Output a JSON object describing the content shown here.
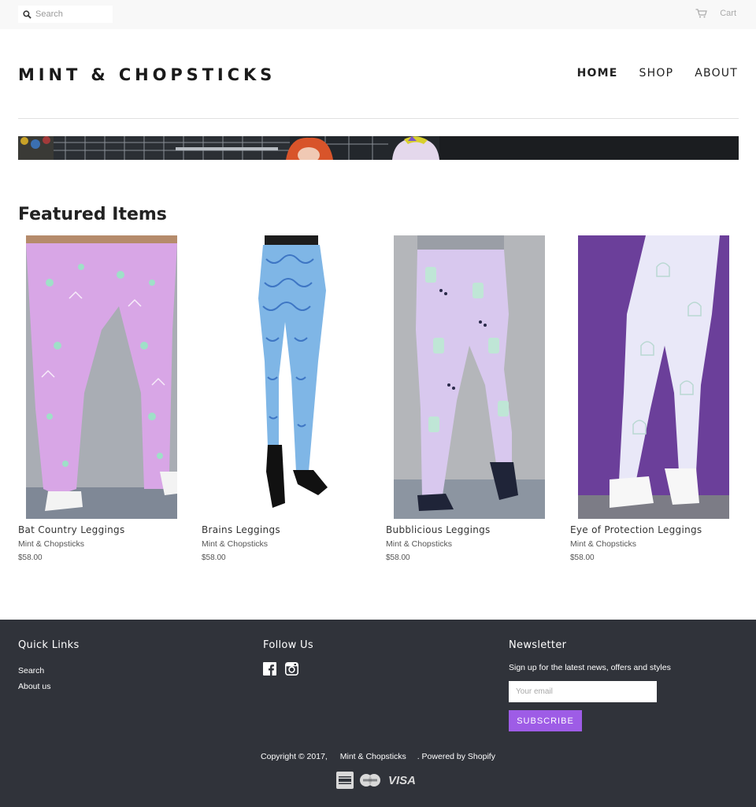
{
  "topbar": {
    "search_placeholder": "Search",
    "cart_label": "Cart"
  },
  "header": {
    "logo": "MINT & CHOPSTICKS",
    "nav": [
      "HOME",
      "SHOP",
      "ABOUT"
    ]
  },
  "featured": {
    "title": "Featured Items",
    "products": [
      {
        "name": "Bat Country Leggings",
        "vendor": "Mint & Chopsticks",
        "price": "$58.00"
      },
      {
        "name": "Brains Leggings",
        "vendor": "Mint & Chopsticks",
        "price": "$58.00"
      },
      {
        "name": "Bubblicious Leggings",
        "vendor": "Mint & Chopsticks",
        "price": "$58.00"
      },
      {
        "name": "Eye of Protection Leggings",
        "vendor": "Mint & Chopsticks",
        "price": "$58.00"
      }
    ]
  },
  "footer": {
    "quick_links_title": "Quick Links",
    "quick_links": [
      "Search",
      "About us"
    ],
    "follow_title": "Follow Us",
    "social_icons": [
      "facebook-icon",
      "instagram-icon"
    ],
    "newsletter_title": "Newsletter",
    "newsletter_text": "Sign up for the latest news, offers and styles",
    "email_placeholder": "Your email",
    "subscribe_label": "SUBSCRIBE",
    "copyright_prefix": "Copyright © 2017,",
    "copyright_store": "Mint & Chopsticks",
    "copyright_powered": ". Powered by Shopify",
    "payment_icons": [
      "american-express-icon",
      "mastercard-icon",
      "visa-icon"
    ],
    "visa_text": "VISA"
  },
  "colors": {
    "footer_bg": "#30333a",
    "accent": "#9e5ce6",
    "topbar_bg": "#f8f8f8"
  }
}
